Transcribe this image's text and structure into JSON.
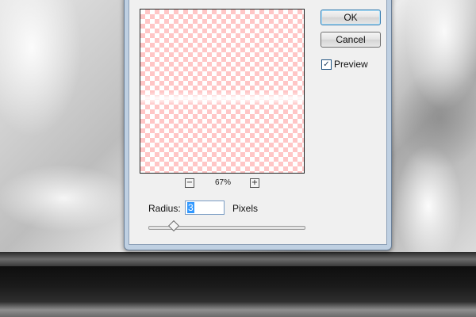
{
  "dialog": {
    "ok_label": "OK",
    "cancel_label": "Cancel",
    "preview_label": "Preview",
    "preview_checked": true,
    "check_glyph": "✓",
    "zoom": {
      "minus_glyph": "−",
      "plus_glyph": "+",
      "level": "67%"
    },
    "radius": {
      "label": "Radius:",
      "value": "3",
      "unit": "Pixels",
      "slider_fraction": 0.16
    }
  },
  "colors": {
    "checker": "#ffc6c6",
    "accent": "#3399ff",
    "window_frame": "#bfd0e2"
  }
}
